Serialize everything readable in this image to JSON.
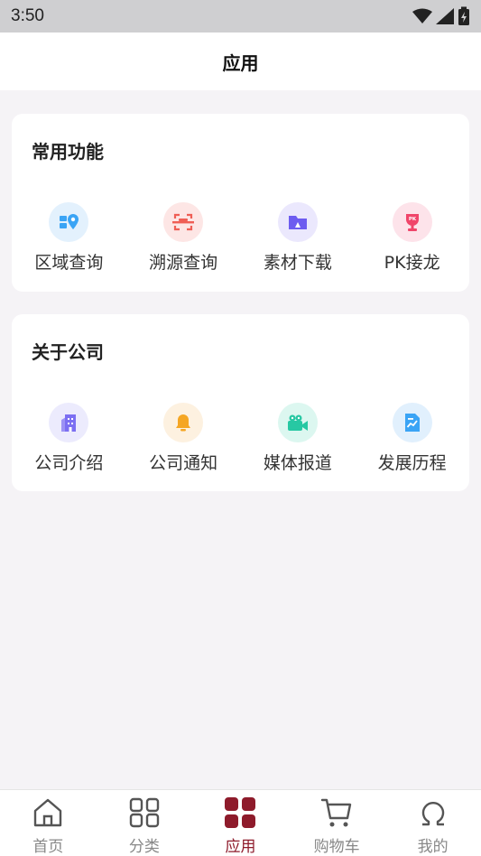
{
  "status_bar": {
    "time": "3:50"
  },
  "header": {
    "title": "应用"
  },
  "sections": [
    {
      "title": "常用功能",
      "items": [
        {
          "label": "区域查询",
          "icon": "map-pin-icon",
          "color": "#3aa4f5",
          "bg": "#e3f1fd"
        },
        {
          "label": "溯源查询",
          "icon": "scan-icon",
          "color": "#ef5e55",
          "bg": "#fde6e5"
        },
        {
          "label": "素材下载",
          "icon": "folder-icon",
          "color": "#6d5cf0",
          "bg": "#ebe8fd"
        },
        {
          "label": "PK接龙",
          "icon": "trophy-icon",
          "color": "#f0456a",
          "bg": "#fde3ea"
        }
      ]
    },
    {
      "title": "关于公司",
      "items": [
        {
          "label": "公司介绍",
          "icon": "building-icon",
          "color": "#7b6ff2",
          "bg": "#ecebfd"
        },
        {
          "label": "公司通知",
          "icon": "bell-icon",
          "color": "#f5a623",
          "bg": "#fdf1e0"
        },
        {
          "label": "媒体报道",
          "icon": "video-camera-icon",
          "color": "#27c8a3",
          "bg": "#dcf7f0"
        },
        {
          "label": "发展历程",
          "icon": "chart-document-icon",
          "color": "#3aa4f5",
          "bg": "#e1f0fd"
        }
      ]
    }
  ],
  "tabbar": {
    "active_color": "#8e1b2b",
    "items": [
      {
        "label": "首页",
        "icon": "home-icon"
      },
      {
        "label": "分类",
        "icon": "category-grid-icon"
      },
      {
        "label": "应用",
        "icon": "apps-icon",
        "active": true
      },
      {
        "label": "购物车",
        "icon": "cart-icon"
      },
      {
        "label": "我的",
        "icon": "omega-user-icon"
      }
    ]
  }
}
